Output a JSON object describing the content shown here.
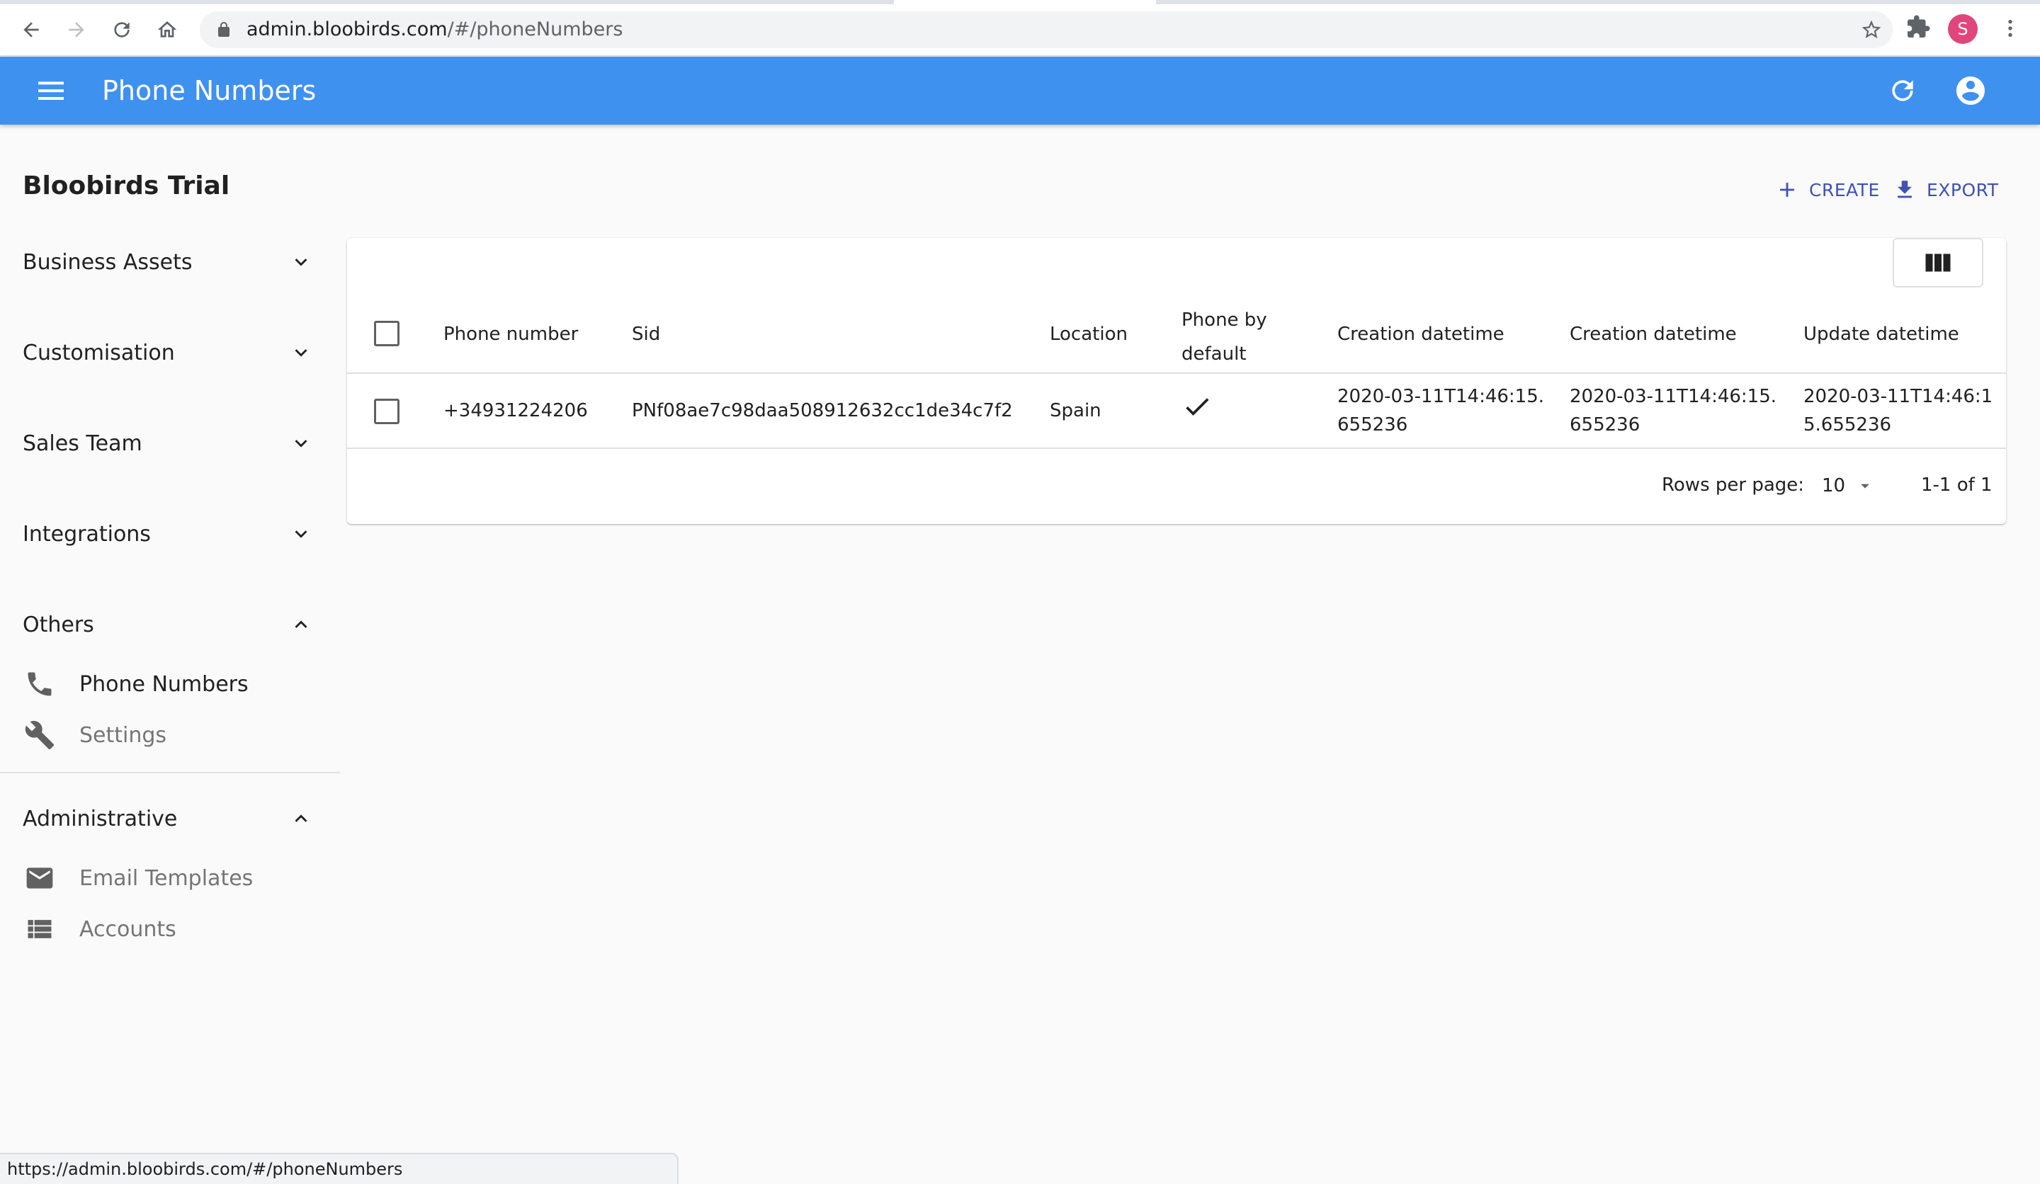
{
  "browser": {
    "url_host": "admin.bloobirds.com",
    "url_path": "/#/phoneNumbers",
    "profile_initial": "S",
    "status_url": "https://admin.bloobirds.com/#/phoneNumbers"
  },
  "appbar": {
    "title": "Phone Numbers"
  },
  "sidebar": {
    "org_name": "Bloobirds Trial",
    "groups": [
      {
        "label": "Business Assets",
        "expanded": false
      },
      {
        "label": "Customisation",
        "expanded": false
      },
      {
        "label": "Sales Team",
        "expanded": false
      },
      {
        "label": "Integrations",
        "expanded": false
      },
      {
        "label": "Others",
        "expanded": true
      },
      {
        "label": "Administrative",
        "expanded": true
      }
    ],
    "others_items": [
      {
        "label": "Phone Numbers",
        "icon": "phone-icon",
        "active": true
      },
      {
        "label": "Settings",
        "icon": "wrench-icon",
        "active": false
      }
    ],
    "admin_items": [
      {
        "label": "Email Templates",
        "icon": "email-icon",
        "active": false
      },
      {
        "label": "Accounts",
        "icon": "list-icon",
        "active": false
      }
    ]
  },
  "actions": {
    "create": "CREATE",
    "export": "EXPORT"
  },
  "table": {
    "columns": [
      "Phone number",
      "Sid",
      "Location",
      "Phone by default",
      "Creation datetime",
      "Creation datetime",
      "Update datetime"
    ],
    "rows": [
      {
        "phone_number": "+34931224206",
        "sid": "PNf08ae7c98daa508912632cc1de34c7f2",
        "location": "Spain",
        "phone_by_default": true,
        "creation_datetime_1": "2020-03-11T14:46:15.655236",
        "creation_datetime_2": "2020-03-11T14:46:15.655236",
        "update_datetime": "2020-03-11T14:46:15.655236"
      }
    ],
    "pagination": {
      "rows_per_page_label": "Rows per page:",
      "rows_per_page": "10",
      "range": "1-1 of 1"
    }
  },
  "colors": {
    "appbar": "#3f91f0",
    "accent": "#3f51b5",
    "profile": "#e0457b"
  }
}
